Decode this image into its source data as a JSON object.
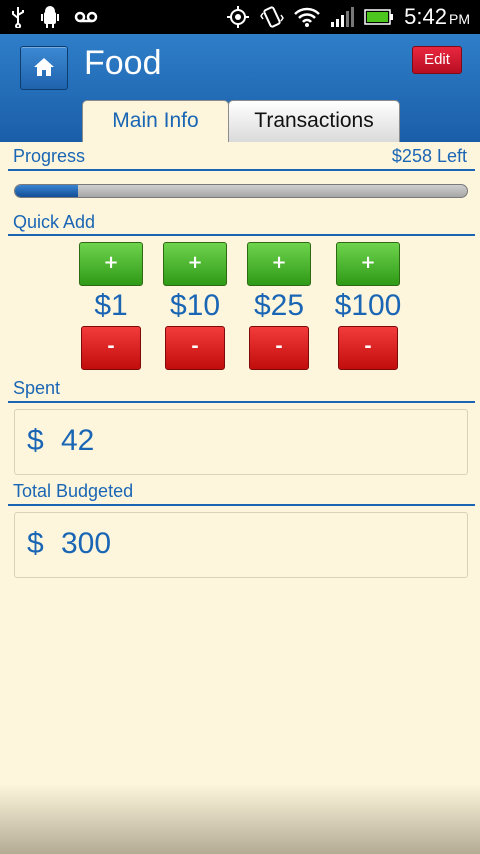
{
  "status_bar": {
    "time": "5:42",
    "ampm": "PM",
    "icons": [
      "usb-icon",
      "android-debug-icon",
      "voicemail-icon",
      "gps-icon",
      "vibrate-icon",
      "wifi-icon",
      "signal-icon",
      "battery-icon"
    ]
  },
  "header": {
    "title": "Food",
    "edit_label": "Edit",
    "home_icon": "home-icon",
    "accent_color": "#1a66b5"
  },
  "tabs": [
    {
      "label": "Main Info",
      "selected": true
    },
    {
      "label": "Transactions",
      "selected": false
    }
  ],
  "progress": {
    "label": "Progress",
    "remaining_label": "$258 Left",
    "fraction": 0.14
  },
  "quick_add": {
    "label": "Quick Add",
    "items": [
      {
        "plus": "+",
        "amount": "$1",
        "minus": "-"
      },
      {
        "plus": "+",
        "amount": "$10",
        "minus": "-"
      },
      {
        "plus": "+",
        "amount": "$25",
        "minus": "-"
      },
      {
        "plus": "+",
        "amount": "$100",
        "minus": "-"
      }
    ]
  },
  "spent": {
    "label": "Spent",
    "currency": "$",
    "value": "42"
  },
  "total_budgeted": {
    "label": "Total Budgeted",
    "currency": "$",
    "value": "300"
  }
}
